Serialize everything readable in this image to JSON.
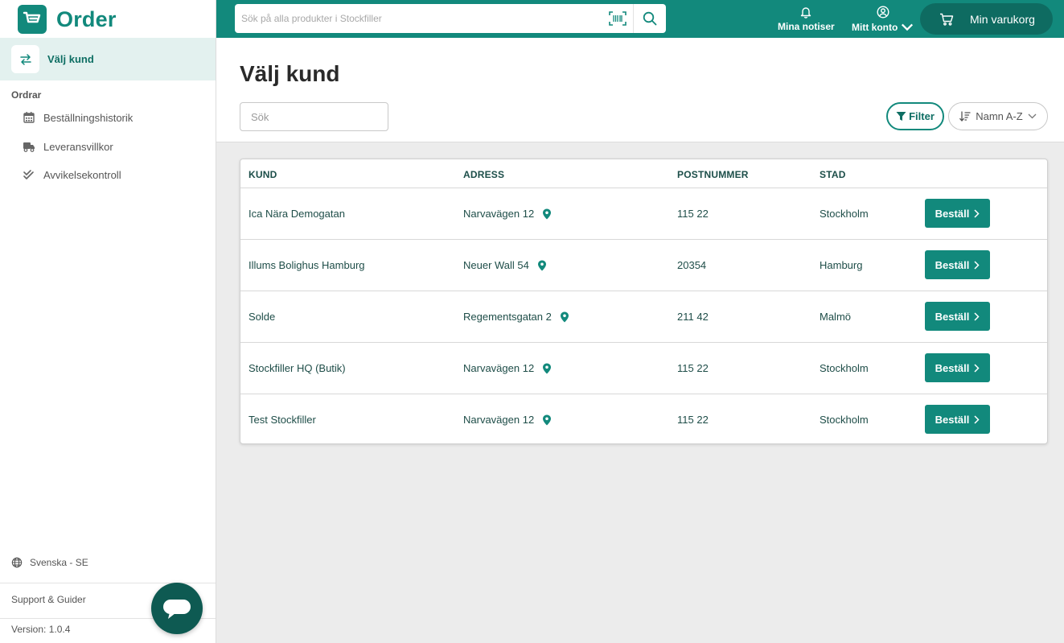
{
  "brand": {
    "name": "Order",
    "color": "#12897c"
  },
  "sidebar": {
    "select_customer": "Välj kund",
    "section_title": "Ordrar",
    "items": [
      {
        "label": "Beställningshistorik",
        "icon": "calendar-icon"
      },
      {
        "label": "Leveransvillkor",
        "icon": "truck-icon"
      },
      {
        "label": "Avvikelsekontroll",
        "icon": "double-check-icon"
      }
    ],
    "language": "Svenska - SE",
    "support": "Support & Guider",
    "version": "Version: 1.0.4"
  },
  "topbar": {
    "search_placeholder": "Sök på alla produkter i Stockfiller",
    "notifications": "Mina notiser",
    "account": "Mitt konto",
    "cart": "Min varukorg"
  },
  "page": {
    "title": "Välj kund",
    "search_placeholder": "Sök",
    "filter_label": "Filter",
    "sort_label": "Namn A-Z"
  },
  "table": {
    "headers": {
      "customer": "KUND",
      "address": "ADRESS",
      "postcode": "POSTNUMMER",
      "city": "STAD"
    },
    "order_label": "Beställ",
    "rows": [
      {
        "customer": "Ica Nära Demogatan",
        "address": "Narvavägen 12",
        "postcode": "115 22",
        "city": "Stockholm"
      },
      {
        "customer": "Illums Bolighus Hamburg",
        "address": "Neuer Wall 54",
        "postcode": "20354",
        "city": "Hamburg"
      },
      {
        "customer": "Solde",
        "address": "Regementsgatan 2",
        "postcode": "211 42",
        "city": "Malmö"
      },
      {
        "customer": "Stockfiller HQ (Butik)",
        "address": "Narvavägen 12",
        "postcode": "115 22",
        "city": "Stockholm"
      },
      {
        "customer": "Test Stockfiller",
        "address": "Narvavägen 12",
        "postcode": "115 22",
        "city": "Stockholm"
      }
    ]
  },
  "colors": {
    "primary": "#12897c",
    "primary_dark": "#0e6b61",
    "chat": "#0e5a52"
  }
}
